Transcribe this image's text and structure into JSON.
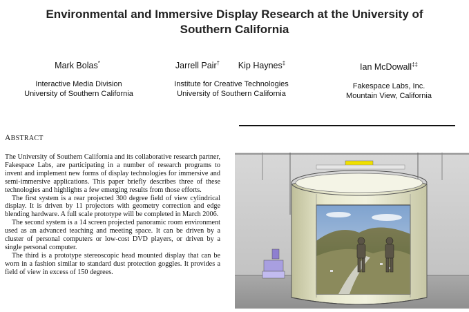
{
  "paper": {
    "title_line1": "Environmental and Immersive Display Research at the University of",
    "title_line2": "Southern California"
  },
  "authors": [
    {
      "name": "Mark Bolas",
      "mark": "*"
    },
    {
      "name": "Jarrell Pair",
      "mark": "†"
    },
    {
      "name": "Kip Haynes",
      "mark": "‡"
    },
    {
      "name": "Ian McDowall",
      "mark": "‡‡"
    }
  ],
  "affiliations": [
    {
      "line1": "Interactive Media Division",
      "line2": "University of Southern California"
    },
    {
      "line1": "Institute for Creative Technologies",
      "line2": "University of Southern California"
    },
    {
      "line1": "Fakespace Labs, Inc.",
      "line2": "Mountain View, California"
    }
  ],
  "abstract": {
    "heading_first": "A",
    "heading_rest": "BSTRACT",
    "paragraphs": [
      "The University of Southern California and its collaborative research partner, Fakespace Labs, are participating in a number of research programs to invent and implement new forms of display technologies for immersive and semi-immersive applications. This paper briefly describes three of these technologies and highlights a few emerging results from those efforts.",
      "The first system is a rear projected 300 degree field of view cylindrical display. It is driven by 11 projectors with geometry correction and edge blending hardware. A full scale prototype will be completed in March 2006.",
      "The second system is a 14 screen projected panoramic room environment used as an advanced teaching and meeting space. It can be driven by a cluster of personal computers or low-cost DVD players, or driven by a single personal computer.",
      "The third is a prototype stereoscopic head mounted display that can be worn in a fashion similar to standard dust protection goggles. It provides a field of view in excess of 150 degrees."
    ]
  },
  "figure": {
    "icon": "cylindrical-display-rendering"
  }
}
